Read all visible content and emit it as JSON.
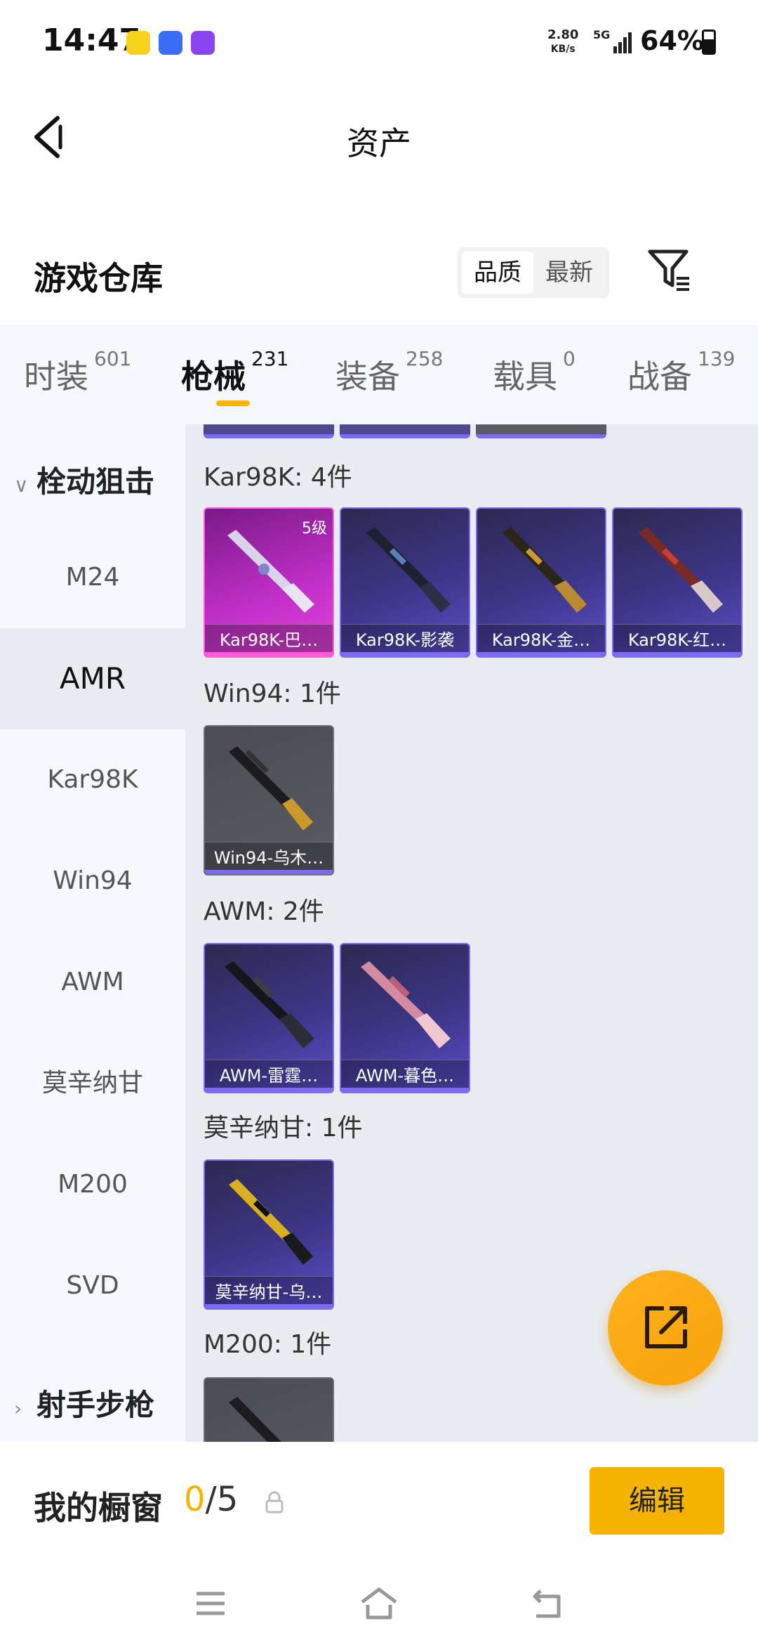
{
  "status_bar": {
    "time": "14:47",
    "net_speed": "2.80",
    "net_unit": "KB/s",
    "network": "5G",
    "battery": "64%"
  },
  "header": {
    "title": "资产"
  },
  "warehouse": {
    "title": "游戏仓库",
    "sort_options": [
      "品质",
      "最新"
    ],
    "selected_sort": "品质"
  },
  "tabs": [
    {
      "label": "时装",
      "count": "601"
    },
    {
      "label": "枪械",
      "count": "231"
    },
    {
      "label": "装备",
      "count": "258"
    },
    {
      "label": "载具",
      "count": "0"
    },
    {
      "label": "战备",
      "count": "139"
    }
  ],
  "active_tab": "枪械",
  "sidebar": {
    "category_1": "栓动狙击",
    "items": [
      "M24",
      "AMR",
      "Kar98K",
      "Win94",
      "AWM",
      "莫辛纳甘",
      "M200",
      "SVD"
    ],
    "active_item": "AMR",
    "category_2": "射手步枪"
  },
  "groups": [
    {
      "label": "Kar98K: 4件",
      "items": [
        {
          "name": "Kar98K-巴…",
          "level": "5级",
          "rarity": "pink"
        },
        {
          "name": "Kar98K-影袭",
          "rarity": "purple"
        },
        {
          "name": "Kar98K-金…",
          "rarity": "purple"
        },
        {
          "name": "Kar98K-红…",
          "rarity": "purple"
        }
      ]
    },
    {
      "label": "Win94: 1件",
      "items": [
        {
          "name": "Win94-乌木…",
          "rarity": "gray"
        }
      ]
    },
    {
      "label": "AWM: 2件",
      "items": [
        {
          "name": "AWM-雷霆…",
          "rarity": "purple"
        },
        {
          "name": "AWM-暮色…",
          "rarity": "purple"
        }
      ]
    },
    {
      "label": "莫辛纳甘: 1件",
      "items": [
        {
          "name": "莫辛纳甘-乌…",
          "rarity": "purple"
        }
      ]
    },
    {
      "label": "M200: 1件",
      "items": []
    }
  ],
  "showcase": {
    "label": "我的橱窗",
    "current": "0",
    "total": "/5",
    "edit_label": "编辑"
  },
  "colors": {
    "accent": "#f6b300",
    "rare_purple": "#5b4fc9",
    "rare_pink": "#e243d9"
  }
}
